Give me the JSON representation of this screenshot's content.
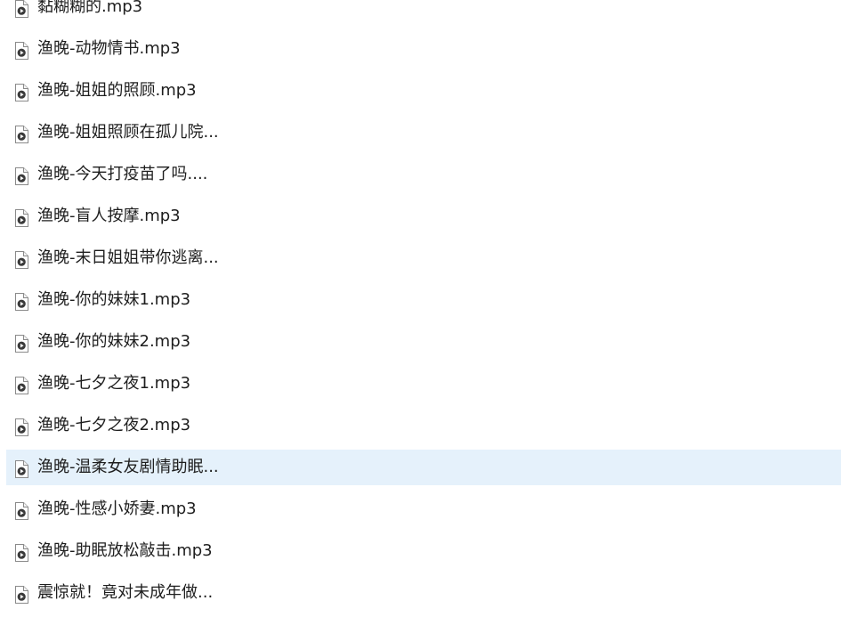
{
  "files": [
    {
      "name": "黏糊糊的.mp3",
      "icon": "audio-file-icon",
      "selected": false
    },
    {
      "name": "渔晚-动物情书.mp3",
      "icon": "audio-file-icon",
      "selected": false
    },
    {
      "name": "渔晚-姐姐的照顾.mp3",
      "icon": "audio-file-icon",
      "selected": false
    },
    {
      "name": "渔晚-姐姐照顾在孤儿院...",
      "icon": "audio-file-icon",
      "selected": false
    },
    {
      "name": "渔晚-今天打疫苗了吗....",
      "icon": "audio-file-icon",
      "selected": false
    },
    {
      "name": "渔晚-盲人按摩.mp3",
      "icon": "audio-file-icon",
      "selected": false
    },
    {
      "name": "渔晚-末日姐姐带你逃离...",
      "icon": "audio-file-icon",
      "selected": false
    },
    {
      "name": "渔晚-你的妹妹1.mp3",
      "icon": "audio-file-icon",
      "selected": false
    },
    {
      "name": "渔晚-你的妹妹2.mp3",
      "icon": "audio-file-icon",
      "selected": false
    },
    {
      "name": "渔晚-七夕之夜1.mp3",
      "icon": "audio-file-icon",
      "selected": false
    },
    {
      "name": "渔晚-七夕之夜2.mp3",
      "icon": "audio-file-icon",
      "selected": false
    },
    {
      "name": "渔晚-温柔女友剧情助眠...",
      "icon": "audio-file-icon",
      "selected": true
    },
    {
      "name": "渔晚-性感小娇妻.mp3",
      "icon": "audio-file-icon",
      "selected": false
    },
    {
      "name": "渔晚-助眠放松敲击.mp3",
      "icon": "audio-file-icon",
      "selected": false
    },
    {
      "name": "震惊就！竟对未成年做...",
      "icon": "audio-file-icon",
      "selected": false
    }
  ],
  "colors": {
    "selection_bg": "#e5f1fb",
    "text": "#1e1e1e",
    "icon_play": "#3a3a3a"
  }
}
